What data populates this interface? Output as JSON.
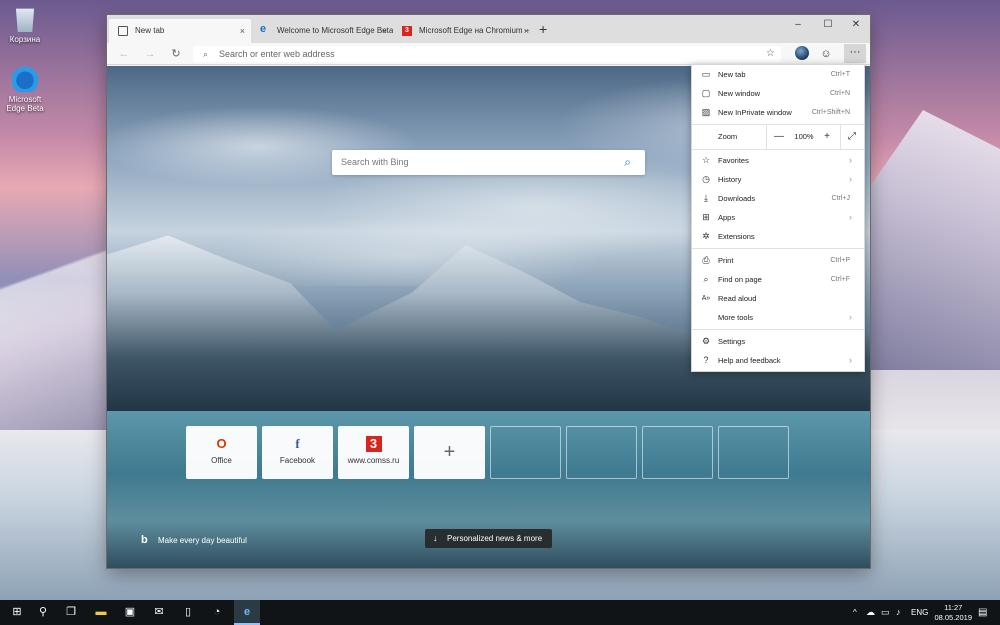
{
  "desktop": {
    "icons": [
      {
        "label": "Корзина",
        "icon": "recycle-bin-icon"
      },
      {
        "label": "Microsoft Edge Beta",
        "icon": "edge-beta-icon"
      }
    ]
  },
  "browser": {
    "tabs": [
      {
        "title": "New tab",
        "icon": "new-tab-icon",
        "active": true,
        "close": "×"
      },
      {
        "title": "Welcome to Microsoft Edge Beta",
        "icon": "edge-icon",
        "active": false,
        "close": "×"
      },
      {
        "title": "Microsoft Edge на Chromium – ",
        "icon": "comss-icon",
        "active": false,
        "close": "×"
      }
    ],
    "new_tab_symbol": "+",
    "window_controls": {
      "minimize": "–",
      "maximize": "☐",
      "close": "✕"
    },
    "toolbar": {
      "back": "←",
      "forward": "→",
      "refresh": "↻",
      "address_placeholder": "Search or enter web address",
      "favorite_star": "☆",
      "emoji": "☺",
      "menu": "···"
    },
    "page": {
      "search_placeholder": "Search with Bing",
      "tiles": [
        {
          "label": "Office",
          "icon": "office-icon",
          "glyph": "O"
        },
        {
          "label": "Facebook",
          "icon": "facebook-icon",
          "glyph": "f"
        },
        {
          "label": "www.comss.ru",
          "icon": "comss-icon",
          "glyph": "3"
        },
        {
          "label": "",
          "icon": "add-icon",
          "glyph": "+"
        }
      ],
      "bing_logo": "b",
      "bing_caption": "Make every day beautiful",
      "news_button": "Personalized news & more",
      "news_arrow": "↓"
    },
    "menu": {
      "items": [
        {
          "label": "New tab",
          "shortcut": "Ctrl+T",
          "icon": "tab-icon",
          "glyph": "▭"
        },
        {
          "label": "New window",
          "shortcut": "Ctrl+N",
          "icon": "window-icon",
          "glyph": "▢"
        },
        {
          "label": "New InPrivate window",
          "shortcut": "Ctrl+Shift+N",
          "icon": "inprivate-icon",
          "glyph": "▨"
        },
        {
          "label": "Favorites",
          "shortcut": "",
          "icon": "star-icon",
          "glyph": "☆",
          "submenu": true
        },
        {
          "label": "History",
          "shortcut": "",
          "icon": "history-icon",
          "glyph": "◷",
          "submenu": true
        },
        {
          "label": "Downloads",
          "shortcut": "Ctrl+J",
          "icon": "download-icon",
          "glyph": "⤓"
        },
        {
          "label": "Apps",
          "shortcut": "",
          "icon": "apps-icon",
          "glyph": "⊞",
          "submenu": true
        },
        {
          "label": "Extensions",
          "shortcut": "",
          "icon": "extension-icon",
          "glyph": "✲"
        },
        {
          "label": "Print",
          "shortcut": "Ctrl+P",
          "icon": "print-icon",
          "glyph": "⎙"
        },
        {
          "label": "Find on page",
          "shortcut": "Ctrl+F",
          "icon": "find-icon",
          "glyph": "⌕"
        },
        {
          "label": "Read aloud",
          "shortcut": "",
          "icon": "read-aloud-icon",
          "glyph": "A»"
        },
        {
          "label": "More tools",
          "shortcut": "",
          "icon": "",
          "glyph": "",
          "submenu": true
        },
        {
          "label": "Settings",
          "shortcut": "",
          "icon": "gear-icon",
          "glyph": "⚙"
        },
        {
          "label": "Help and feedback",
          "shortcut": "",
          "icon": "help-icon",
          "glyph": "?",
          "submenu": true
        }
      ],
      "zoom": {
        "label": "Zoom",
        "minus": "—",
        "value": "100%",
        "plus": "+",
        "fullscreen": "⤢"
      },
      "chevron": "›"
    }
  },
  "taskbar": {
    "start": "⊞",
    "search": "⚲",
    "task_view": "❐",
    "apps": [
      {
        "name": "explorer",
        "glyph": "▬"
      },
      {
        "name": "store",
        "glyph": "▣"
      },
      {
        "name": "mail",
        "glyph": "✉"
      },
      {
        "name": "phone",
        "glyph": "▯"
      },
      {
        "name": "clock-app",
        "glyph": "◔"
      },
      {
        "name": "edge-beta",
        "glyph": "e"
      }
    ],
    "tray": {
      "chevron": "^",
      "language": "ENG",
      "time": "11:27",
      "date": "08.05.2019",
      "notifications": "▤"
    }
  }
}
